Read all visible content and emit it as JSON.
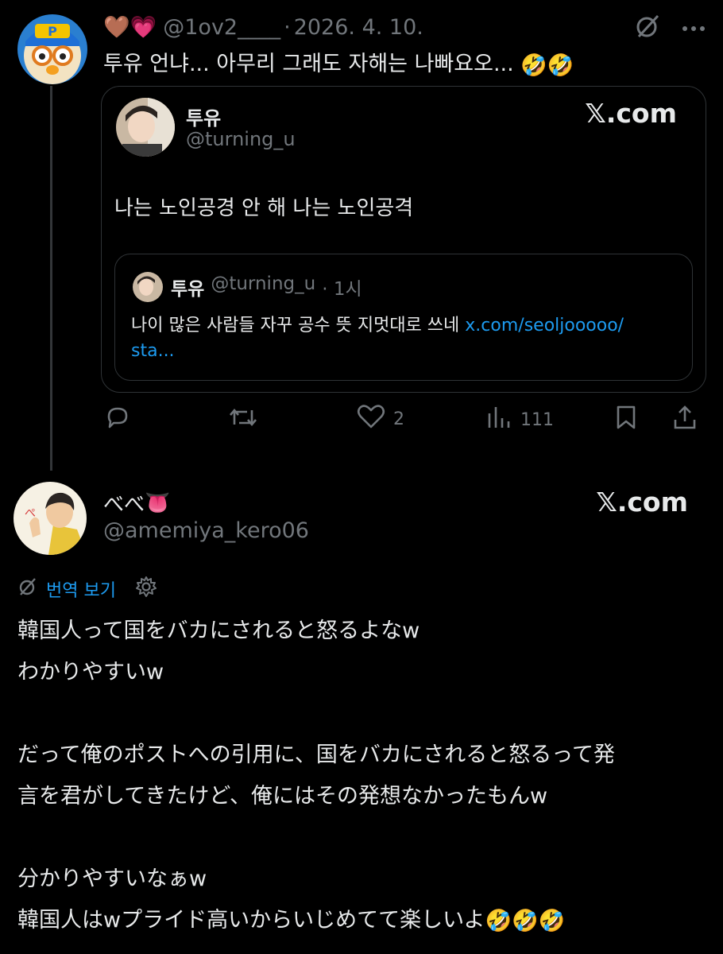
{
  "post1": {
    "display_name_emoji": "🤎💗",
    "handle": "@1ov2____",
    "separator": "·",
    "date": "2026. 4. 10.",
    "text": "투유 언냐... 아무리 그래도 자해는 나빠요오...",
    "text_emoji": "🤣🤣",
    "embedded": {
      "name": "투유",
      "handle": "@turning_u",
      "source": "𝕏.com",
      "text": "나는 노인공경 안 해 나는 노인공격",
      "quote": {
        "name": "투유",
        "handle": "@turning_u",
        "time": "· 1시",
        "text": "나이 많은 사람들 자꾸 공수 뜻 지멋대로 쓰네 ",
        "link": "x.com/seoljooooo/",
        "link_cont": "sta..."
      }
    },
    "actions": {
      "reply_count": "",
      "repost_count": "",
      "like_count": "2",
      "views_count": "111"
    }
  },
  "post2": {
    "name": "べべ",
    "name_emoji": "👅",
    "handle": "@amemiya_kero06",
    "source": "𝕏.com",
    "translate_label": "번역 보기",
    "lines": [
      "韓国人って国をバカにされると怒るよなw",
      "わかりやすいw",
      "",
      "だって俺のポストへの引用に、国をバカにされると怒るって発",
      "言を君がしてきたけど、俺にはその発想なかったもんw",
      "",
      "分かりやすいなぁw",
      "韓国人はwプライド高いからいじめてて楽しいよ"
    ],
    "last_line_emoji": "🤣🤣🤣"
  },
  "colors": {
    "background": "#000000",
    "text": "#e7e9ea",
    "muted": "#71767b",
    "link": "#1d9bf0",
    "border": "#2f3336"
  }
}
